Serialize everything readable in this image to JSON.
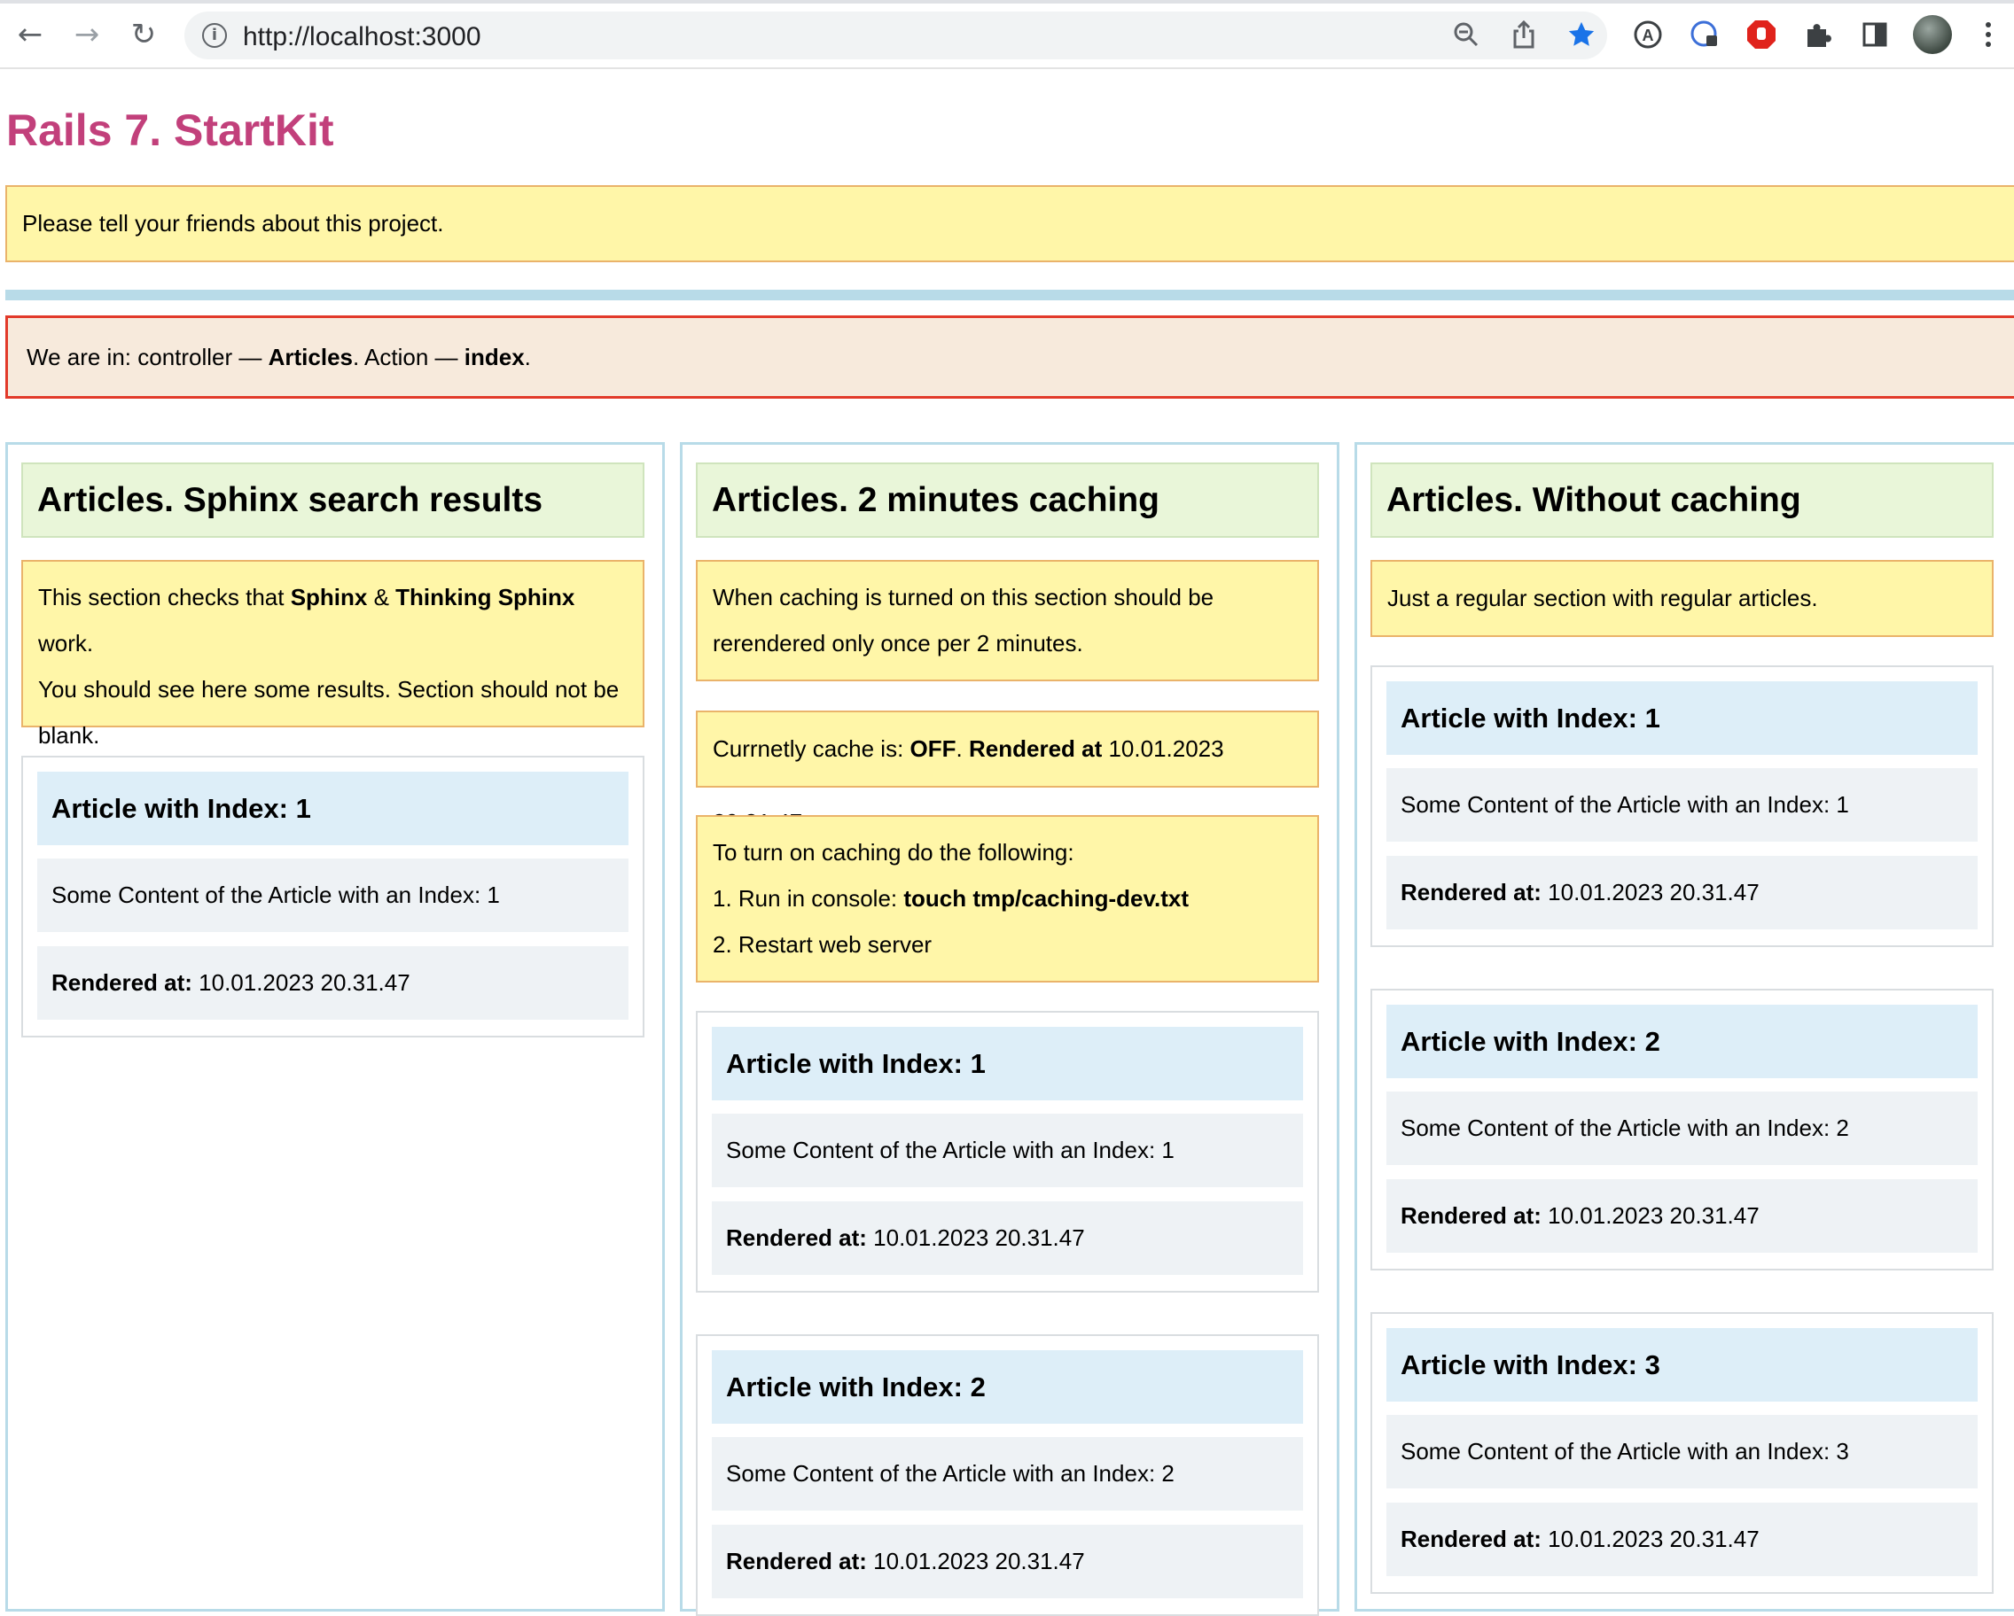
{
  "browser": {
    "url": "http://localhost:3000",
    "icons": {
      "back": "arrow-left-icon",
      "forward": "arrow-right-icon",
      "reload": "reload-icon",
      "zoom": "zoom-out-icon",
      "share": "share-icon",
      "bookmark": "star-icon",
      "extensions": [
        "translate-icon",
        "password-icon",
        "adblock-icon",
        "puzzle-icon",
        "side-panel-icon"
      ],
      "menu": "kebab-menu-icon"
    },
    "accent_color": "#1a73e8"
  },
  "page": {
    "title": "Rails 7. StartKit",
    "title_color": "#c2407b",
    "notice": "Please tell your friends about this project.",
    "controller_prefix": "We are in: controller — ",
    "controller_name": "Articles",
    "action_prefix": ". Action — ",
    "action_name": "index",
    "action_suffix": "."
  },
  "columns": [
    {
      "header": "Articles. Sphinx search results",
      "info": {
        "part1": "This section checks that ",
        "bold1": "Sphinx",
        "part2": " & ",
        "bold2": "Thinking Sphinx",
        "part3": " work.",
        "line2": "You should see here some results. Section should not be",
        "line3": "blank."
      },
      "articles": [
        {
          "title": "Article with Index: 1",
          "content": "Some Content of the Article with an Index: 1",
          "rendered_label": "Rendered at:",
          "rendered_value": " 10.01.2023 20.31.47"
        }
      ]
    },
    {
      "header": "Articles. 2 minutes caching",
      "info": {
        "line1": "When caching is turned on this section should be",
        "line2": "rerendered only once per 2 minutes."
      },
      "cache_status": {
        "prefix": "Currnetly cache is: ",
        "state": "OFF",
        "sep": ". ",
        "rendered_label": "Rendered at",
        "rendered_value": " 10.01.2023 20.31.47"
      },
      "instructions": {
        "line1": "To turn on caching do the following:",
        "step1_prefix": "1. Run in console: ",
        "step1_cmd": "touch tmp/caching-dev.txt",
        "step2": "2. Restart web server"
      },
      "articles": [
        {
          "title": "Article with Index: 1",
          "content": "Some Content of the Article with an Index: 1",
          "rendered_label": "Rendered at:",
          "rendered_value": " 10.01.2023 20.31.47"
        },
        {
          "title": "Article with Index: 2",
          "content": "Some Content of the Article with an Index: 2",
          "rendered_label": "Rendered at:",
          "rendered_value": " 10.01.2023 20.31.47"
        }
      ]
    },
    {
      "header": "Articles. Without caching",
      "info": {
        "line1": "Just a regular section with regular articles."
      },
      "articles": [
        {
          "title": "Article with Index: 1",
          "content": "Some Content of the Article with an Index: 1",
          "rendered_label": "Rendered at:",
          "rendered_value": " 10.01.2023 20.31.47"
        },
        {
          "title": "Article with Index: 2",
          "content": "Some Content of the Article with an Index: 2",
          "rendered_label": "Rendered at:",
          "rendered_value": " 10.01.2023 20.31.47"
        },
        {
          "title": "Article with Index: 3",
          "content": "Some Content of the Article with an Index: 3",
          "rendered_label": "Rendered at:",
          "rendered_value": " 10.01.2023 20.31.47"
        }
      ]
    }
  ]
}
